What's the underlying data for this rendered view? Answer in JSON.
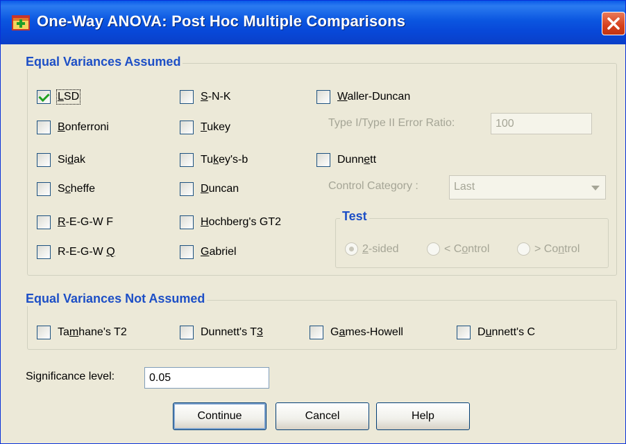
{
  "window": {
    "title": "One-Way ANOVA: Post Hoc Multiple Comparisons"
  },
  "equal_assumed": {
    "title": "Equal Variances Assumed",
    "col1": [
      {
        "pre": "",
        "u": "L",
        "post": "SD",
        "checked": true
      },
      {
        "pre": "",
        "u": "B",
        "post": "onferroni",
        "checked": false
      },
      {
        "pre": "Si",
        "u": "d",
        "post": "ak",
        "checked": false
      },
      {
        "pre": "S",
        "u": "c",
        "post": "heffe",
        "checked": false
      },
      {
        "pre": "",
        "u": "R",
        "post": "-E-G-W F",
        "checked": false
      },
      {
        "pre": "R-E-G-W ",
        "u": "Q",
        "post": "",
        "checked": false
      }
    ],
    "col2": [
      {
        "pre": "",
        "u": "S",
        "post": "-N-K",
        "checked": false
      },
      {
        "pre": "",
        "u": "T",
        "post": "ukey",
        "checked": false
      },
      {
        "pre": "Tu",
        "u": "k",
        "post": "ey's-b",
        "checked": false
      },
      {
        "pre": "",
        "u": "D",
        "post": "uncan",
        "checked": false
      },
      {
        "pre": "",
        "u": "H",
        "post": "ochberg's GT2",
        "checked": false
      },
      {
        "pre": "",
        "u": "G",
        "post": "abriel",
        "checked": false
      }
    ],
    "waller": {
      "pre": "",
      "u": "W",
      "post": "aller-Duncan",
      "checked": false
    },
    "error_ratio_label": "Type I/Type II Error Ratio:",
    "error_ratio_value": "100",
    "dunnett": {
      "pre": "Dunn",
      "u": "e",
      "post": "tt",
      "checked": false
    },
    "control_category_label": "Control Category :",
    "control_category_value": "Last",
    "test": {
      "title": "Test",
      "options": [
        {
          "pre": "",
          "u": "2",
          "post": "-sided",
          "selected": true
        },
        {
          "pre": "< C",
          "u": "o",
          "post": "ntrol",
          "selected": false
        },
        {
          "pre": "> Co",
          "u": "n",
          "post": "trol",
          "selected": false
        }
      ]
    }
  },
  "equal_not_assumed": {
    "title": "Equal Variances Not Assumed",
    "items": [
      {
        "pre": "Ta",
        "u": "m",
        "post": "hane's T2",
        "checked": false
      },
      {
        "pre": "Dunnett's T",
        "u": "3",
        "post": "",
        "checked": false
      },
      {
        "pre": "G",
        "u": "a",
        "post": "mes-Howell",
        "checked": false
      },
      {
        "pre": "D",
        "u": "u",
        "post": "nnett's C",
        "checked": false
      }
    ]
  },
  "significance": {
    "label": "Significance level:",
    "value": "0.05"
  },
  "buttons": {
    "continue": "Continue",
    "cancel": "Cancel",
    "help": "Help"
  },
  "colors": {
    "title_bar": "#0a5ae8",
    "group_title": "#1d4fc6",
    "dialog_bg": "#ece9d8",
    "disabled_text": "#a5a596",
    "check_mark": "#21a121"
  }
}
